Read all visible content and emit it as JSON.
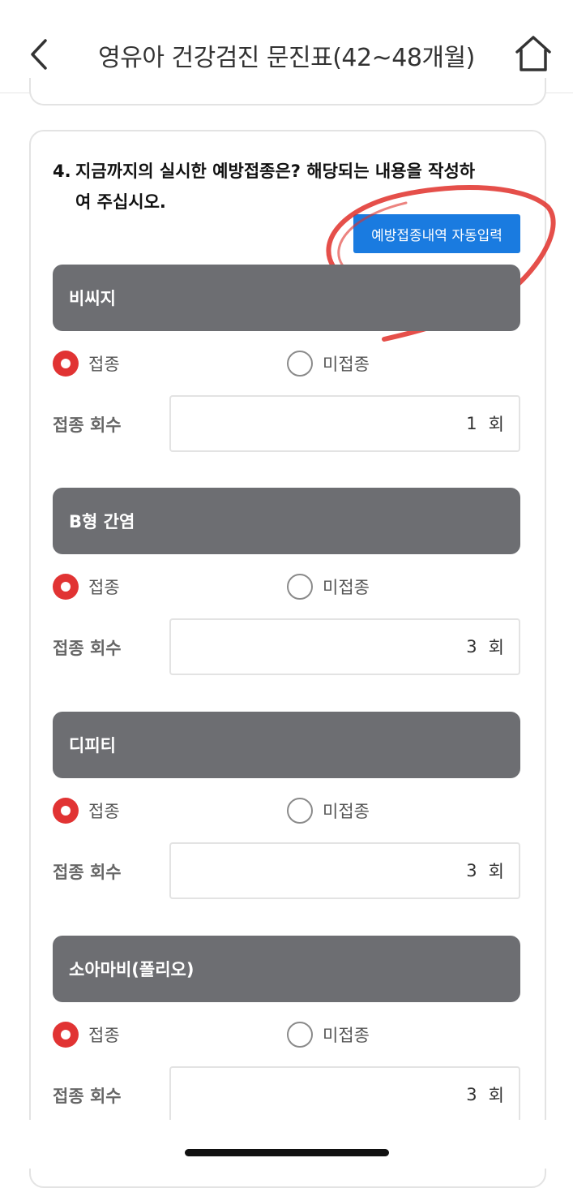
{
  "header": {
    "title": "영유아 건강검진 문진표(42~48개월)"
  },
  "question": {
    "number": "4.",
    "text_line1": "지금까지의 실시한 예방접종은? 해당되는 내용을 작성하",
    "text_line2": "여 주십시오.",
    "auto_fill_label": "예방접종내역 자동입력"
  },
  "vaccines": [
    {
      "name": "비씨지",
      "option_yes": "접종",
      "option_no": "미접종",
      "selected": "접종",
      "count_label": "접종 회수",
      "count": "1",
      "unit": "회"
    },
    {
      "name": "B형 간염",
      "option_yes": "접종",
      "option_no": "미접종",
      "selected": "접종",
      "count_label": "접종 회수",
      "count": "3",
      "unit": "회"
    },
    {
      "name": "디피티",
      "option_yes": "접종",
      "option_no": "미접종",
      "selected": "접종",
      "count_label": "접종 회수",
      "count": "3",
      "unit": "회"
    },
    {
      "name": "소아마비(폴리오)",
      "option_yes": "접종",
      "option_no": "미접종",
      "selected": "접종",
      "count_label": "접종 회수",
      "count": "3",
      "unit": "회"
    }
  ],
  "colors": {
    "accent_blue": "#1a7be0",
    "radio_selected": "#e13333",
    "vaccine_header_bg": "#6d6e72",
    "annotation_red": "#e0302a"
  }
}
